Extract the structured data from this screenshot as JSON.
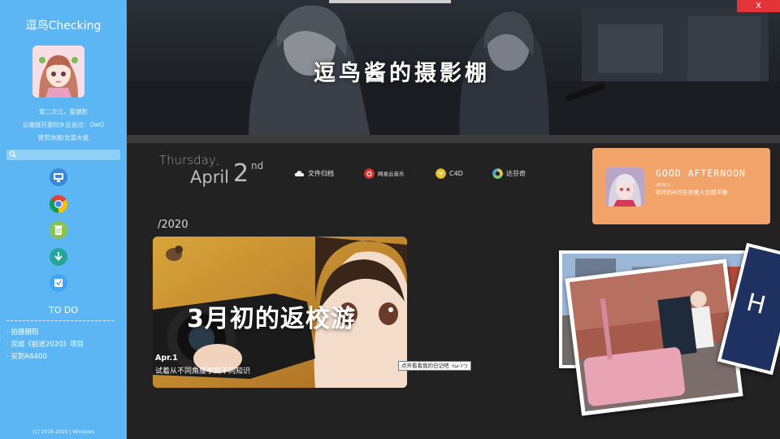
{
  "sidebar": {
    "brand": "逗鸟Checking",
    "motto_lines": [
      "爱二次元，爱摄影",
      "云端接开源同乡总说过：OwO",
      "赞赏你朋/女装大佬"
    ],
    "search": {
      "placeholder": ""
    },
    "apps": [
      "desktop-icon",
      "chrome-icon",
      "trash-icon",
      "download-icon",
      "save-icon"
    ],
    "todo_title": "TO DO",
    "todo_items": [
      "· 拍摄朝阳",
      "· 完成《前进2020》项目",
      "· 买到A6400"
    ],
    "footer": "(C) 2018-2020 | Windows"
  },
  "header": {
    "banner_title": "逗鸟酱的摄影棚",
    "close_label": "X"
  },
  "date": {
    "weekday": "Thursday,",
    "month": "April",
    "day": "2",
    "suffix": "nd"
  },
  "quick_links": [
    {
      "label": "文件归档",
      "icon": "cloud-icon"
    },
    {
      "label": "网易云音乐",
      "icon": "netease-music-icon"
    },
    {
      "label": "C4D",
      "icon": "c4d-icon"
    },
    {
      "label": "达芬奇",
      "icon": "davinci-icon"
    }
  ],
  "greeting": {
    "title": "GOOD AFTERNOON",
    "date": "2020.1",
    "text": "明年的4月往往使人空間平静"
  },
  "timeline": {
    "year": "/2020",
    "post": {
      "title": "3月初的返校游",
      "date": "Apr.1",
      "subtitle": "试着从不同角度学到不同知识"
    },
    "tooltip": "点开看看我的日记吧 ·(ω·)つ"
  },
  "colors": {
    "sidebar": "#5bb6f3",
    "background": "#222222",
    "greeting_card": "#f2a36a",
    "close": "#e3343a"
  }
}
